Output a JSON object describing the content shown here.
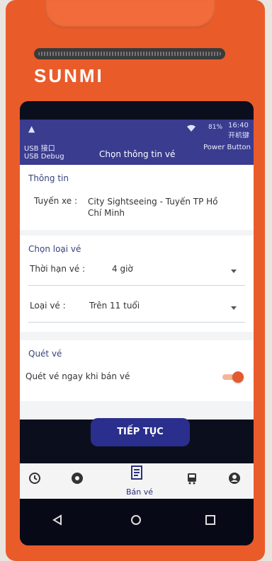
{
  "device": {
    "brand": "SUNMI"
  },
  "status_bar": {
    "warning_icon": "▲",
    "battery": "81%",
    "time": "16:40",
    "time_label": "开机键"
  },
  "app_bar": {
    "usb_line1": "USB 接口",
    "usb_line2": "USB Debug",
    "title": "Chọn thông tin vé",
    "power_label": "Power Button"
  },
  "info_section": {
    "title": "Thông tin",
    "route_label": "Tuyến xe :",
    "route_value": "City Sightseeing - Tuyến TP Hồ Chí Minh"
  },
  "ticket_type_section": {
    "title": "Chọn loại vé",
    "duration_label": "Thời hạn vé :",
    "duration_value": "4 giờ",
    "type_label": "Loại vé :",
    "type_value": "Trên 11 tuổi"
  },
  "scan_section": {
    "title": "Quét vé",
    "toggle_label": "Quét vé ngay khi bán vé"
  },
  "cta": {
    "label": "TIẾP TỤC"
  },
  "bottom_nav": {
    "sell_label": "Bán vé"
  },
  "colors": {
    "accent": "#2a2e8c",
    "brand": "#ea5b2a",
    "toggle": "#e45a2e"
  }
}
